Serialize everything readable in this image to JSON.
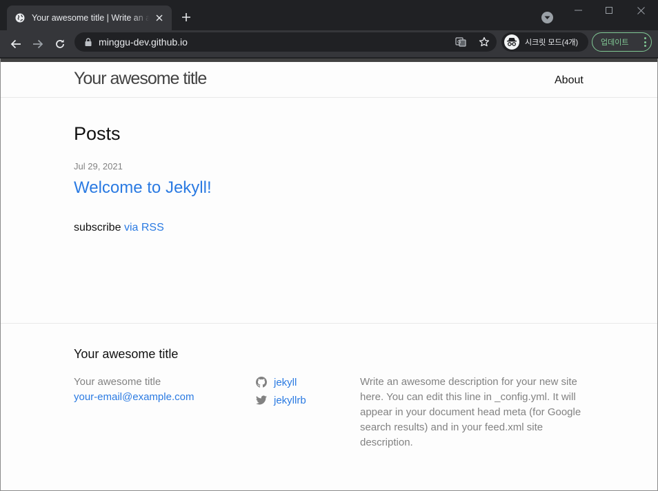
{
  "browser": {
    "tab": {
      "title": "Your awesome title | Write an awesome description for your new site"
    },
    "omnibox": {
      "url": "minggu-dev.github.io"
    },
    "incognito": {
      "label": "시크릿 모드(4개)"
    },
    "update": {
      "label": "업데이트"
    },
    "icons": [
      "globe-icon",
      "close-icon",
      "plus-icon",
      "tab-search-icon",
      "minimize-icon",
      "maximize-icon",
      "window-close-icon",
      "back-arrow-icon",
      "forward-arrow-icon",
      "reload-icon",
      "lock-icon",
      "translate-icon",
      "star-icon",
      "incognito-icon",
      "more-vert-icon"
    ]
  },
  "site": {
    "header": {
      "title": "Your awesome title",
      "nav_about": "About"
    },
    "posts": {
      "heading": "Posts",
      "items": [
        {
          "date": "Jul 29, 2021",
          "title": "Welcome to Jekyll!"
        }
      ]
    },
    "subscribe": {
      "text": "subscribe",
      "link": "via RSS"
    },
    "footer": {
      "heading": "Your awesome title",
      "name": "Your awesome title",
      "email": "your-email@example.com",
      "social": [
        {
          "icon": "github-icon",
          "label": "jekyll"
        },
        {
          "icon": "twitter-icon",
          "label": "jekyllrb"
        }
      ],
      "description": "Write an awesome description for your new site here. You can edit this line in _config.yml. It will appear in your document head meta (for Google search results) and in your feed.xml site description."
    }
  },
  "colors": {
    "link": "#2a7ae2",
    "text": "#111111",
    "muted": "#828282",
    "chrome_dark": "#202124",
    "chrome_tab": "#35363a",
    "update_green": "#81c995"
  }
}
